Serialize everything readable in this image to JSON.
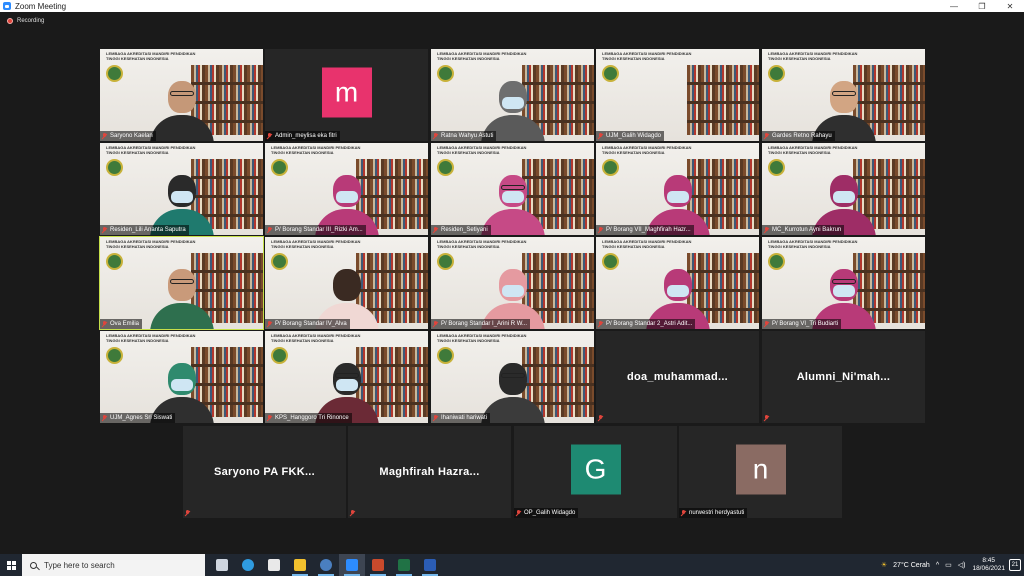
{
  "window": {
    "title": "Zoom Meeting",
    "minimize": "—",
    "maximize": "❐",
    "close": "✕"
  },
  "recording": {
    "label": "Recording"
  },
  "tiles": [
    {
      "name": "Saryono Kaelan",
      "type": "video",
      "head": "#c59878",
      "body": "#2b2b2b",
      "mask": false,
      "glasses": true
    },
    {
      "name": "Admin_meylisa eka fitri",
      "type": "avatar",
      "initial": "m",
      "color": "#e8336d"
    },
    {
      "name": "Ratna Wahyu Astuti",
      "type": "video",
      "head": "#6e6e6e",
      "body": "#5a5a5a",
      "mask": true,
      "glasses": false
    },
    {
      "name": "UJM_Galih Widagdo",
      "type": "video-empty"
    },
    {
      "name": "Gardes Retno Rahayu",
      "type": "video",
      "head": "#d2a583",
      "body": "#2f2f2f",
      "mask": false,
      "glasses": true
    },
    {
      "name": "Residen_Lili Ananta Saputra",
      "type": "video",
      "head": "#2a2a2a",
      "body": "#1f7a6e",
      "mask": true,
      "glasses": false
    },
    {
      "name": "P/ Borang Standar III_Rizki Am...",
      "type": "video",
      "head": "#b83a78",
      "body": "#b83a78",
      "mask": true,
      "glasses": false
    },
    {
      "name": "Residen_Setiyani",
      "type": "video",
      "head": "#c64a86",
      "body": "#c64a86",
      "mask": true,
      "glasses": true
    },
    {
      "name": "P/ Borang VII_Maghfirah Hazr...",
      "type": "video",
      "head": "#b83a78",
      "body": "#b83a78",
      "mask": true,
      "glasses": false
    },
    {
      "name": "MC_Kurrotun Ayni Bakrun",
      "type": "video",
      "head": "#9e2d66",
      "body": "#9e2d66",
      "mask": true,
      "glasses": false
    },
    {
      "name": "Ova Emilia",
      "type": "video",
      "head": "#c99a7a",
      "body": "#2e6f4e",
      "mask": false,
      "glasses": true,
      "active": true
    },
    {
      "name": "P/ Borang Standar IV_Alva",
      "type": "video",
      "head": "#3a2a22",
      "body": "#f0d8d4",
      "mask": false,
      "glasses": false
    },
    {
      "name": "P/ Borang Standar I_Arini R W...",
      "type": "video",
      "head": "#e59aa0",
      "body": "#e59aa0",
      "mask": true,
      "glasses": false
    },
    {
      "name": "P/ Borang Standar 2_Astri Adit...",
      "type": "video",
      "head": "#b83a78",
      "body": "#b83a78",
      "mask": true,
      "glasses": false
    },
    {
      "name": "P/ Borang VI_Tri Budiarti",
      "type": "video",
      "head": "#b83a78",
      "body": "#b83a78",
      "mask": true,
      "glasses": true
    },
    {
      "name": "UJM_Agnes Sri Siswati",
      "type": "video",
      "head": "#2f8a6e",
      "body": "#2f2f2f",
      "mask": true,
      "glasses": false
    },
    {
      "name": "KPS_Hanggoro Tri Rinonce",
      "type": "video",
      "head": "#2a2a2a",
      "body": "#6b2a36",
      "mask": true,
      "glasses": true
    },
    {
      "name": "Ihaniwati hariwati",
      "type": "video",
      "head": "#2a2a2a",
      "body": "#3b3b3b",
      "mask": false,
      "glasses": true
    },
    {
      "name": "",
      "type": "text",
      "bigname": "doa_muhammad..."
    },
    {
      "name": "",
      "type": "text",
      "bigname": "Alumni_Ni'mah..."
    },
    {
      "name": "",
      "type": "text",
      "bigname": "Saryono PA FKK..."
    },
    {
      "name": "",
      "type": "text",
      "bigname": "Maghfirah Hazra..."
    },
    {
      "name": "OP_Galih Widagdo",
      "type": "avatar",
      "initial": "G",
      "color": "#1e8a72"
    },
    {
      "name": "nurwestri herdyastuti",
      "type": "avatar",
      "initial": "n",
      "color": "#8a6b63"
    }
  ],
  "banner_text": "LEMBAGA AKREDITASI MANDIRI PENDIDIKAN TINGGI KESEHATAN INDONESIA",
  "taskbar": {
    "search_placeholder": "Type here to search",
    "weather": "27°C  Cerah",
    "time": "8:45",
    "date": "18/06/2021",
    "notifications": "21",
    "apps": [
      "task-view",
      "edge",
      "store",
      "file-explorer",
      "photos",
      "zoom",
      "powerpoint",
      "excel",
      "word"
    ],
    "app_colors": [
      "#cfd6e0",
      "#2f9be0",
      "#e9e9e9",
      "#f2c12e",
      "#4a7fc0",
      "#2d8cff",
      "#c94a2c",
      "#207245",
      "#2b5db5"
    ]
  }
}
